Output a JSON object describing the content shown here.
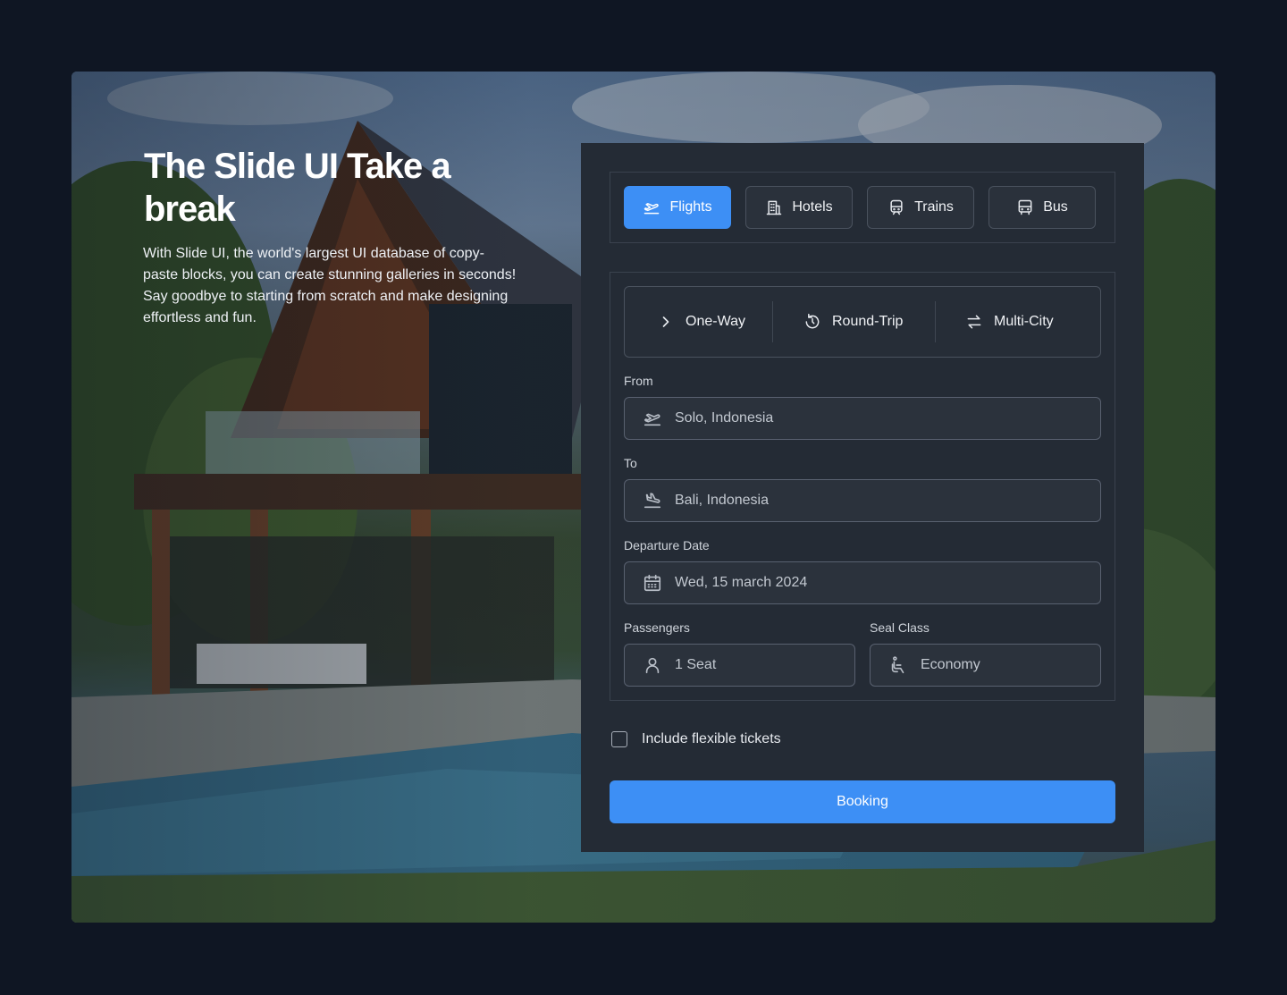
{
  "hero": {
    "title": "The Slide UI Take a break",
    "description": "With Slide UI, the world's largest UI database of copy-paste blocks, you can create stunning galleries in seconds! Say goodbye to starting from scratch and make designing effortless and fun."
  },
  "tabs": [
    {
      "label": "Flights",
      "icon": "plane-takeoff-icon",
      "active": true
    },
    {
      "label": "Hotels",
      "icon": "building-icon",
      "active": false
    },
    {
      "label": "Trains",
      "icon": "train-icon",
      "active": false
    },
    {
      "label": "Bus",
      "icon": "bus-icon",
      "active": false
    }
  ],
  "trip_types": [
    {
      "label": "One-Way",
      "icon": "chevron-right-icon"
    },
    {
      "label": "Round-Trip",
      "icon": "rotate-icon"
    },
    {
      "label": "Multi-City",
      "icon": "arrows-swap-icon"
    }
  ],
  "form": {
    "from_label": "From",
    "from_value": "Solo, Indonesia",
    "to_label": "To",
    "to_value": "Bali, Indonesia",
    "date_label": "Departure Date",
    "date_value": "Wed, 15 march 2024",
    "passengers_label": "Passengers",
    "passengers_value": "1 Seat",
    "class_label": "Seal Class",
    "class_value": "Economy"
  },
  "flexible_label": "Include flexible tickets",
  "booking_label": "Booking",
  "colors": {
    "accent": "#3d8ff5",
    "card": "#242b35",
    "page": "#0f1623"
  }
}
